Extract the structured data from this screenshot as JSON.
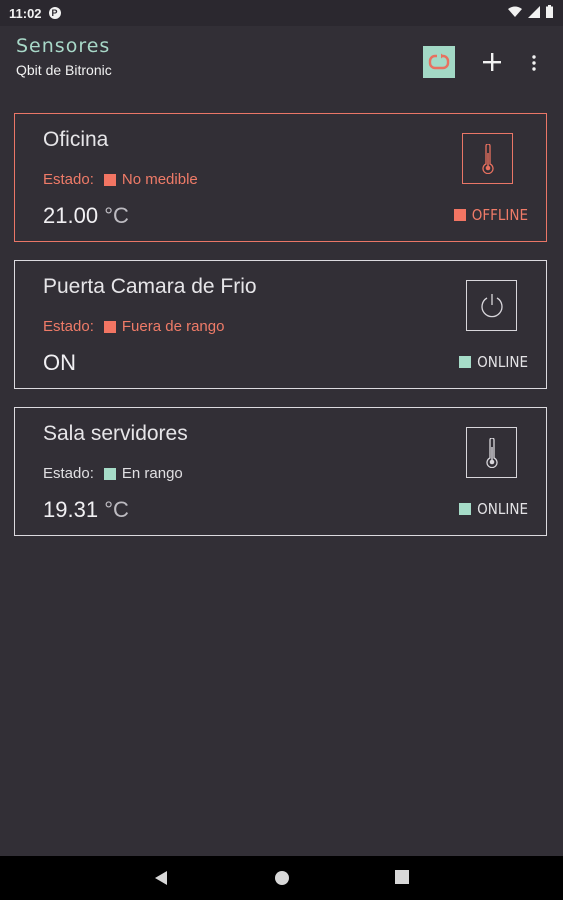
{
  "status_bar": {
    "time": "11:02",
    "app_badge": "P",
    "icons": [
      "wifi-icon",
      "signal-icon",
      "battery-icon"
    ]
  },
  "appbar": {
    "title": "Sensores",
    "subtitle": "Qbit de Bitronic",
    "actions": [
      "refresh-icon",
      "add-icon",
      "more-vert-icon"
    ]
  },
  "colors": {
    "background": "#322f36",
    "accent": "#a3d9c6",
    "alert": "#f27563"
  },
  "sensors": [
    {
      "name": "Oficina",
      "status_label": "Estado:",
      "status_text": "No medible",
      "status_color": "red",
      "value": "21.00",
      "unit": "°C",
      "icon": "thermometer-icon",
      "connection": "OFFLINE"
    },
    {
      "name": "Puerta Camara de Frio",
      "status_label": "Estado:",
      "status_text": "Fuera de rango",
      "status_color": "red",
      "value": "ON",
      "unit": "",
      "icon": "power-icon",
      "connection": "ONLINE"
    },
    {
      "name": "Sala servidores",
      "status_label": "Estado:",
      "status_text": "En rango",
      "status_color": "green",
      "value": "19.31",
      "unit": "°C",
      "icon": "thermometer-icon",
      "connection": "ONLINE"
    }
  ],
  "nav_bar": [
    "back-icon",
    "home-icon",
    "recents-icon"
  ]
}
